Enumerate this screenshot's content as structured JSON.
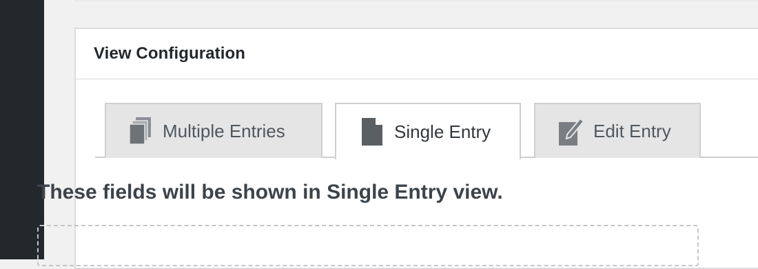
{
  "metabox": {
    "title": "View Configuration"
  },
  "tabs": [
    {
      "label": "Multiple Entries",
      "icon": "multiple-documents-icon",
      "active": false
    },
    {
      "label": "Single Entry",
      "icon": "document-icon",
      "active": true
    },
    {
      "label": "Edit Entry",
      "icon": "edit-document-icon",
      "active": false
    }
  ],
  "content": {
    "heading": "These fields will be shown in Single Entry view."
  },
  "colors": {
    "sidebar": "#23282d",
    "page_bg": "#f1f1f1",
    "tab_inactive_bg": "#e5e5e5",
    "icon": "#5a5f64"
  }
}
